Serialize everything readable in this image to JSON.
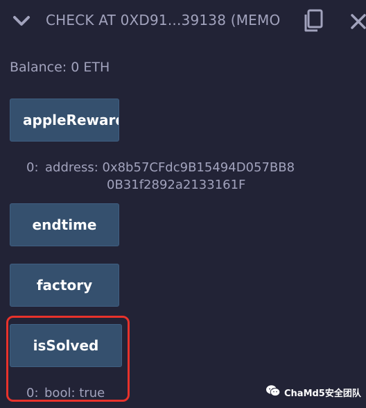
{
  "header": {
    "title": "CHECK AT 0XD91...39138 (MEMO",
    "chevron_icon": "chevron-down-icon",
    "copy_icon": "copy-icon",
    "close_icon": "close-icon"
  },
  "balance": "Balance: 0 ETH",
  "functions": [
    {
      "label": "appleRewardP",
      "outputs": [
        {
          "index": "0:",
          "line1": "address: 0x8b57CFdc9B15494D057BB8",
          "line2": "0B31f2892a2133161F"
        }
      ]
    },
    {
      "label": "endtime"
    },
    {
      "label": "factory"
    },
    {
      "label": "isSolved",
      "highlighted": true,
      "outputs": [
        {
          "index": "0:",
          "line1": "bool: true"
        }
      ]
    }
  ],
  "watermark": {
    "text": "ChaMd5安全团队",
    "icon": "wechat-icon"
  },
  "colors": {
    "background": "#222336",
    "button": "#35506e",
    "text": "#a2a3bd",
    "highlight": "#e8322b"
  }
}
